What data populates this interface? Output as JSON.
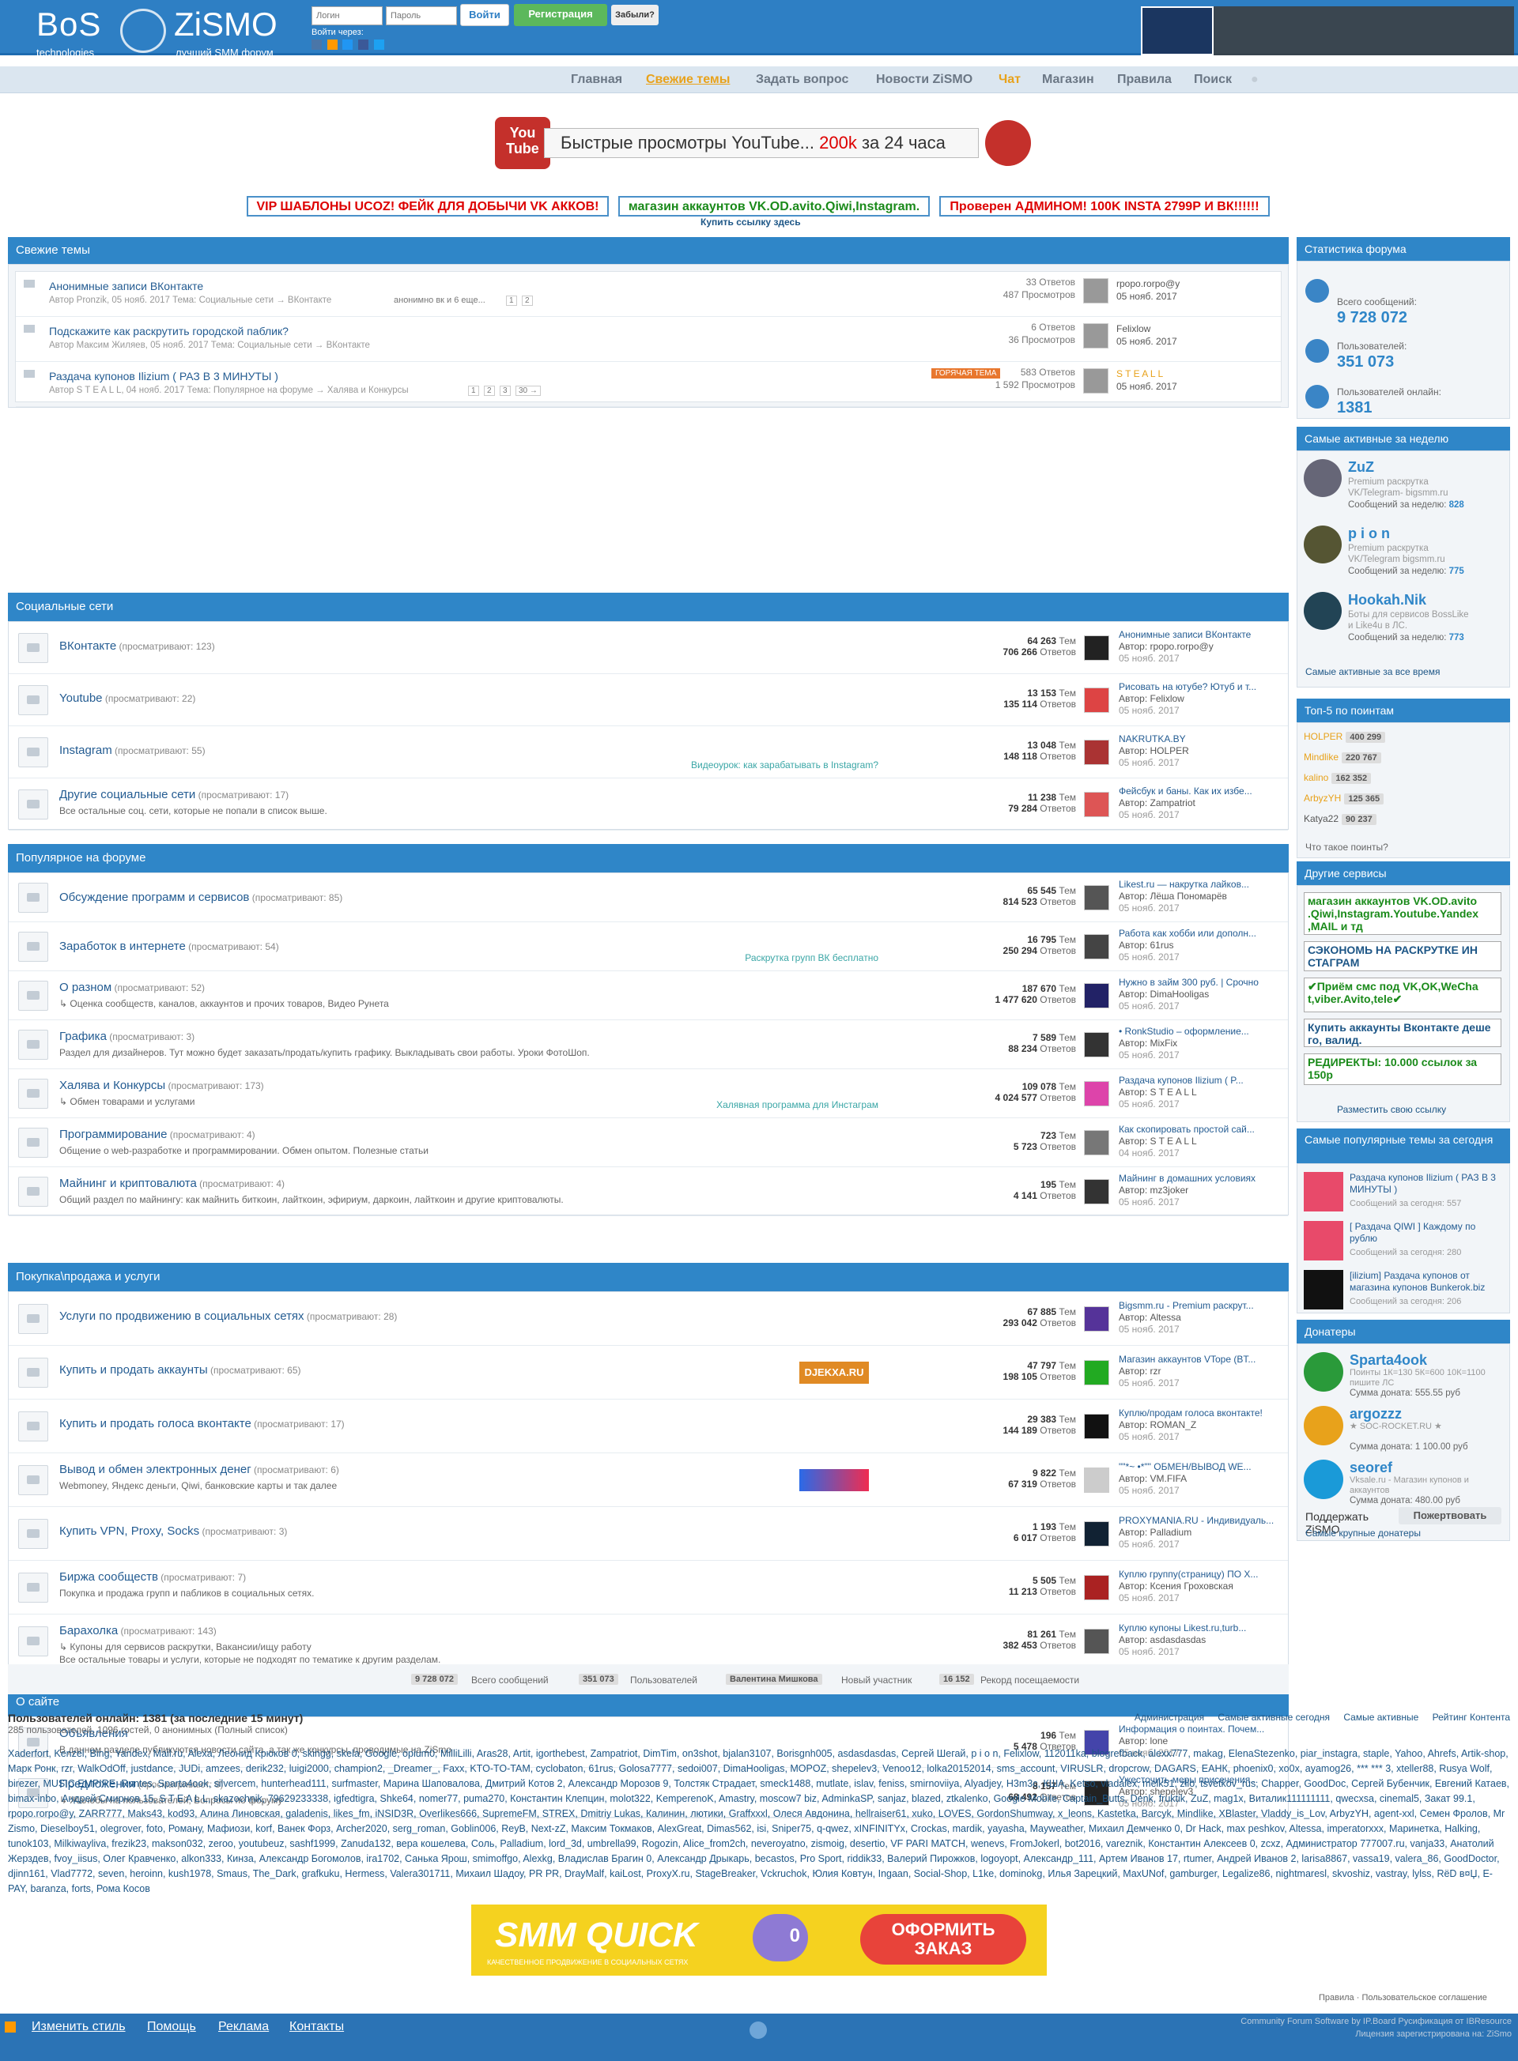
{
  "brand": {
    "left_big": "BoS",
    "left_small": "technologies",
    "right_big": "ZiSMO",
    "right_small": "лучший SMM форум"
  },
  "login": {
    "user_ph": "Логин",
    "pass_ph": "Пароль",
    "login_btn": "Войти",
    "register_btn": "Регистрация",
    "forgot_btn": "Забыли?",
    "via": "Войти через:"
  },
  "nav": {
    "items": [
      "Главная",
      "Свежие темы",
      "Задать вопрос",
      "Новости ZiSMO",
      "Чат",
      "Магазин",
      "Правила",
      "Поиск"
    ],
    "active_color": "#e8a21b"
  },
  "banner": {
    "text_pre": "Быстрые просмотры ",
    "text_yt": "YouTube...",
    "text_red": " 200k",
    "text_post": " за 24 часа",
    "logo_top": "You",
    "logo_bottom": "Tube"
  },
  "ads": {
    "a1": "VIP ШАБЛОНЫ UCOZ! ФЕЙК ДЛЯ ДОБЫЧИ VK АККОВ!",
    "a2": "магазин аккаунтов VK.OD.avito.Qiwi,Instagram.",
    "a3": "Проверен АДМИНОМ! 100K INSTA 2799Р И ВК!!!!!!",
    "buy": "Купить ссылку здесь"
  },
  "fresh": {
    "title": "Свежие темы",
    "topics": [
      {
        "title": "Анонимные записи ВКонтакте",
        "meta": "Автор Pronzik, 05 нояб. 2017 Тема: Социальные сети → ВКонтакте",
        "tag": "анонимно вк и 6 еще...",
        "pages": [
          "1",
          "2"
        ],
        "answers": "33 Ответов",
        "views": "487 Просмотров",
        "user": "rpopo.rorpo@y",
        "date": "05 нояб. 2017"
      },
      {
        "title": "Подскажите как раскрутить городской паблик?",
        "meta": "Автор Максим Жиляев, 05 нояб. 2017 Тема: Социальные сети → ВКонтакте",
        "answers": "6 Ответов",
        "views": "36 Просмотров",
        "user": "Felixlow",
        "date": "05 нояб. 2017"
      },
      {
        "title": "Раздача купонов Ilizium ( РАЗ В 3 МИНУТЫ )",
        "meta": "Автор S T E A L L, 04 нояб. 2017 Тема: Популярное на форуме → Халява и Конкурсы",
        "pages": [
          "1",
          "2",
          "3",
          "30 →"
        ],
        "hot": "ГОРЯЧАЯ ТЕМА",
        "answers": "583 Ответов",
        "views": "1 592 Просмотров",
        "user": "S T E A L L",
        "date": "05 нояб. 2017"
      }
    ]
  },
  "sections": [
    {
      "title": "Социальные сети",
      "forums": [
        {
          "name": "ВКонтакте",
          "view": "(просматривают: 123)",
          "desc": "",
          "mid": "",
          "topics": "64 263",
          "answers": "706 266",
          "last": "Анонимные записи ВКонтакте",
          "author": "Автор: rpopo.rorpo@y",
          "date": "05 нояб. 2017"
        },
        {
          "name": "Youtube",
          "view": "(просматривают: 22)",
          "desc": "",
          "mid": "",
          "topics": "13 153",
          "answers": "135 114",
          "last": "Рисовать на ютубе? Ютуб и т...",
          "author": "Автор: Felixlow",
          "date": "05 нояб. 2017"
        },
        {
          "name": "Instagram",
          "view": "(просматривают: 55)",
          "desc": "",
          "mid": "Видеоурок: как зарабатывать в Instagram?",
          "topics": "13 048",
          "answers": "148 118",
          "last": "NAKRUTKA.BY",
          "author": "Автор: HOLPER",
          "date": "05 нояб. 2017"
        },
        {
          "name": "Другие социальные сети",
          "view": "(просматривают: 17)",
          "desc": "Все остальные соц. сети, которые не попали в список выше.",
          "mid": "",
          "topics": "11 238",
          "answers": "79 284",
          "last": "Фейсбук и баны. Как их избе...",
          "author": "Автор: Zampatriot",
          "date": "05 нояб. 2017"
        }
      ]
    },
    {
      "title": "Популярное на форуме",
      "forums": [
        {
          "name": "Обсуждение программ и сервисов",
          "view": "(просматривают: 85)",
          "desc": "",
          "mid": "",
          "topics": "65 545",
          "answers": "814 523",
          "last": "Likest.ru — накрутка лайков...",
          "author": "Автор: Лёша Пономарёв",
          "date": "05 нояб. 2017"
        },
        {
          "name": "Заработок в интернете",
          "view": "(просматривают: 54)",
          "desc": "",
          "mid": "Раскрутка групп ВК бесплатно",
          "topics": "16 795",
          "answers": "250 294",
          "last": "Работа как хобби или дополн...",
          "author": "Автор: 61rus",
          "date": "05 нояб. 2017"
        },
        {
          "name": "О разном",
          "view": "(просматривают: 52)",
          "desc": "↳ Оценка сообществ, каналов, аккаунтов и прочих товаров,    Видео Рунета",
          "mid": "",
          "topics": "187 670",
          "answers": "1 477 620",
          "last": "Нужно в займ 300 руб. | Срочно",
          "author": "Автор: DimaHooligas",
          "date": "05 нояб. 2017"
        },
        {
          "name": "Графика",
          "view": "(просматривают: 3)",
          "desc": "Раздел для дизайнеров. Тут можно будет заказать/продать/купить графику. Выкладывать свои работы. Уроки ФотоШоп.",
          "mid": "",
          "topics": "7 589",
          "answers": "88 234",
          "last": "• RonkStudio – оформление...",
          "author": "Автор: MixFix",
          "date": "05 нояб. 2017"
        },
        {
          "name": "Халява и Конкурсы",
          "view": "(просматривают: 173)",
          "desc": "↳ Обмен товарами и услугами",
          "mid": "Халявная программа для Инстаграм",
          "topics": "109 078",
          "answers": "4 024 577",
          "last": "Раздача купонов Ilizium ( P...",
          "author": "Автор: S T E A L L",
          "date": "05 нояб. 2017"
        },
        {
          "name": "Программирование",
          "view": "(просматривают: 4)",
          "desc": "Общение о web-разработке и программировании. Обмен опытом. Полезные статьи",
          "mid": "",
          "topics": "723",
          "answers": "5 723",
          "last": "Как скопировать простой сай...",
          "author": "Автор: S T E A L L",
          "date": "04 нояб. 2017"
        },
        {
          "name": "Майнинг и криптовалюта",
          "view": "(просматривают: 4)",
          "desc": "Общий раздел по майнингу: как майнить биткоин, лайткоин, эфириум, даркоин, лайткоин и другие криптовалюты.",
          "mid": "",
          "topics": "195",
          "answers": "4 141",
          "last": "Майнинг в домашних условиях",
          "author": "Автор: mz3joker",
          "date": "05 нояб. 2017"
        }
      ]
    },
    {
      "title": "Покупка\\продажа и услуги",
      "forums": [
        {
          "name": "Услуги по продвижению в социальных сетях",
          "view": "(просматривают: 28)",
          "desc": "",
          "mid": "",
          "topics": "67 885",
          "answers": "293 042",
          "last": "Bigsmm.ru - Premium раскрут...",
          "author": "Автор: Altessa",
          "date": "05 нояб. 2017"
        },
        {
          "name": "Купить и продать аккаунты",
          "view": "(просматривают: 65)",
          "desc": "",
          "mid": "DJEKXA.RU",
          "topics": "47 797",
          "answers": "198 105",
          "last": "Магазин аккаунтов VTope (BT...",
          "author": "Автор: rzr",
          "date": "05 нояб. 2017"
        },
        {
          "name": "Купить и продать голоса вконтакте",
          "view": "(просматривают: 17)",
          "desc": "",
          "mid": "",
          "topics": "29 383",
          "answers": "144 189",
          "last": "Куплю/продам голоса вконтакте!",
          "author": "Автор: ROMAN_Z",
          "date": "05 нояб. 2017"
        },
        {
          "name": "Вывод и обмен электронных денег",
          "view": "(просматривают: 6)",
          "desc": "Webmoney, Яндекс деньги, Qiwi, банковские карты и так далее",
          "mid": "",
          "topics": "9 822",
          "answers": "67 319",
          "last": "\"\"*~ •*\"\" ОБМЕН/ВЫВОД WE...",
          "author": "Автор: VM.FIFA",
          "date": "05 нояб. 2017"
        },
        {
          "name": "Купить VPN, Proxy, Socks",
          "view": "(просматривают: 3)",
          "desc": "",
          "mid": "",
          "topics": "1 193",
          "answers": "6 017",
          "last": "PROXYMANIA.RU - Индивидуаль...",
          "author": "Автор: Palladium",
          "date": "05 нояб. 2017"
        },
        {
          "name": "Биржа сообществ",
          "view": "(просматривают: 7)",
          "desc": "Покупка и продажа групп и пабликов в социальных сетях.",
          "mid": "",
          "topics": "5 505",
          "answers": "11 213",
          "last": "Куплю группу(страницу) ПО Х...",
          "author": "Автор: Ксения Гроховская",
          "date": "05 нояб. 2017"
        },
        {
          "name": "Барахолка",
          "view": "(просматривают: 143)",
          "desc": "↳ Купоны для сервисов раскрутки,    Вакансии/ищу работу",
          "desc2": "Все остальные товары и услуги, которые не подходят по тематике к другим разделам.",
          "mid": "",
          "topics": "81 261",
          "answers": "382 453",
          "last": "Куплю купоны Likest.ru,turb...",
          "author": "Автор: asdasdasdas",
          "date": "05 нояб. 2017"
        }
      ]
    },
    {
      "title": "О сайте",
      "forums": [
        {
          "name": "Объявления",
          "view": "",
          "desc": "В данном разделе публикуются новости сайта, а так же конкурсы, проводимые на ZiSmo",
          "mid": "",
          "topics": "196",
          "answers": "5 478",
          "last": "Информация о поинтах. Почем...",
          "author": "Автор: lone",
          "date": "05 нояб. 2017"
        },
        {
          "name": "Предложения",
          "view": "(просматривают: 8)",
          "desc": "↳ Жалобы на пользователей,    Вопросы по форуму",
          "mid": "",
          "topics": "8 157",
          "answers": "68 492",
          "last": "Ужесточить меры присечения...",
          "author": "Автор: shepelev3",
          "date": "05 нояб. 2017"
        }
      ]
    }
  ],
  "labels": {
    "tem": "Тем",
    "otv": "Ответов"
  },
  "summary": {
    "msgs": "9 728 072",
    "msgs_l": "Всего сообщений",
    "users": "351 073",
    "users_l": "Пользователей",
    "newest": "Валентина Мишкова",
    "newest_l": "Новый участник",
    "record": "16 152",
    "record_l": "Рекорд посещаемости"
  },
  "online": {
    "title": "Пользователей онлайн: 1381 (за последние 15 минут)",
    "sub": "285 пользователей, 1096 гостей, 0 анонимных   (Полный список)",
    "links": [
      "Администрация",
      "Самые активные сегодня",
      "Самые активные",
      "Рейтинг Контента"
    ],
    "text": "Xaderfort, Kenzel, Bing, Yandex, Mail.ru, Alexa, Леонид Крюков 0, skingg, skela, Google, opium0, MilliLilli, Aras28, Artit, igorthebest, Zampatriot, DimTim, on3shot, bjalan3107, Borisgnh005, asdasdasdas, Сергей Шегай, p i o n, Felixlow, 112011ka, blogrefback, alexx777, makag, ElenaStezenko, piar_instagra, staple, Yahoo, Ahrefs, Artik-shop, Марк Ронк, rzr, WalkOdOff, justdance, JUDi, amzees, derik232, luigi2000, champion2, _Dreamer_, Faxx, KTO-TO-TAM, cyclobaton, 61rus, Golosa7777, sedoi007, DimaHooligas, MOPOZ, shepelev3, Venoo12, lolka20152014, sms_account, VIRUSLR, dropcrow, DAGARS, ЕАНК, phoenix0, xo0x, ayamog26, *** *** 3, xteller88, Rusya Wolf, birezer, MUSIC EMPIRE, Runtes, Sparta4ook, silvercem, hunterhead111, surfmaster, Марина Шаповалова, Дмитрий Котов 2, Александр Морозов 9, Толстяк Страдает, smeck1488, mutlate, islav, feniss, smirnoviiya, Alyadjey, H3m3c, КША, Ketso, vladalex, melk51, zllo, tsvetkov_rus, Chapper, GoodDoc, Сергей Бубенчик, Евгений Катаев, bimax-inbo, Андрей Смирнов 15, S T E A L L, skazochnik, 79629233338, igfedtigra, Shke64, nomer77, puma270, Константин Клепцин, molot322, KemperenoK, Amastry, moscow7 biz, AdminkaSP, sanjaz, blazed, ztkalenko, Google Mobile, Captain_Butts, Denk, fruktik, ZuZ, mag1x, Виталик111111111, qwecxsa, cinemal5, Закат 99.1, rpopo.rorpo@y, ZARR777, Maks43, kod93, Алина Линовская, galadenis, likes_fm, iNSID3R, Overlikes666, SupremeFM, STREX, Dmitriy Lukas, Калинин, лютики, Graffxxxl, Олеся Авдонина, hellraiser61, xuko, LOVES, GordonShumway, x_leons, Kastetka, Barcyk, Mindlike, XBlaster, Vladdy_is_Lov, ArbyzYH, agent-xxl, Семен Фролов, Mr Zismo, Dieselboy51, olegrover, foto, Роману, Мафиози, korf, Ванек Форз, Archer2020, serg_roman, Goblin006, ReyB, Next-zZ, Максим Токмаков, AlexGreat, Dimas562, isi, Sniper75, q-qwez, xINFINITYx, Crockas, mardik, yayasha, Mayweather, Михаил Демченко 0, Dr Hack, max peshkov, Altessa, imperatorxxx, Маринетка, Halking, tunok103, Milkiwayliva, frezik23, makson032, zeroo, youtubeuz, sashf1999, Zanuda132, вера кошелева, Соль, Palladium, lord_3d, umbrella99, Rogozin, Alice_from2ch, neveroyatno, zismoig, desertio, VF PARI MATCH, wenevs, FromJokerl, bot2016, vareznik, Константин Алексеев 0, zcxz, Администратор 777007.ru, vanja33, Анатолий Жерздев, fvoy_iisus, Олег Кравченко, alkon333, Кинза, Александр Богомолов, ira1702, Санька Ярош, smimoffgo, Alexkg, Владислав Брагин 0, Александр Дрыкарь, becastos, Pro Sport, riddik33, Валерий Пирожков, logoyopt, Александр_111, Артем Иванов 17, rtumer, Андрей Иванов 2, larisa8867, vassa19, valera_86, GoodDoctor, djinn161, Vlad7772, seven, heroinn, kush1978, Smaus, The_Dark, grafkuku, Hermess, Valera301711, Михаил Шадоу, PR PR, DrayMalf, kaiLost, ProxyX.ru, StageBreaker, Vckruchok, Юлия Ковтун, Ingaan, Social-Shop, L1ke, dominokg, Илья Зарецкий, MaxUNof, gamburger, Legalize86, nightmaresl, skvoshiz, vastray, lylss, RёD в¤Џ, E-PAY, baranza, forts, Рома Косов"
  },
  "side": {
    "stats_title": "Статистика форума",
    "s1_l": "Всего сообщений:",
    "s1": "9 728 072",
    "s2_l": "Пользователей:",
    "s2": "351 073",
    "s3_l": "Пользователей онлайн:",
    "s3": "1381",
    "week_title": "Самые активные за неделю",
    "week": [
      {
        "name": "ZuZ",
        "desc": "Premium раскрутка VK/Telegram- bigsmm.ru",
        "msgs_l": "Сообщений за неделю:",
        "msgs": "828"
      },
      {
        "name": "p i o n",
        "desc": "Premium раскрутка VK/Telegram bigsmm.ru",
        "msgs_l": "Сообщений за неделю:",
        "msgs": "775"
      },
      {
        "name": "Hookah.Nik",
        "desc": "Боты для сервисов BossLike и Like4u в ЛС.",
        "msgs_l": "Сообщений за неделю:",
        "msgs": "773"
      }
    ],
    "alltime": "Самые активные за все время",
    "top5_title": "Топ-5 по поинтам",
    "top5": [
      {
        "n": "HOLPER",
        "p": "400 299"
      },
      {
        "n": "Mindlike",
        "p": "220 767"
      },
      {
        "n": "kalino",
        "p": "162 352"
      },
      {
        "n": "ArbyzYH",
        "p": "125 365"
      },
      {
        "n": "Katya22",
        "p": "90 237"
      }
    ],
    "points_q": "Что такое поинты?",
    "services_title": "Другие сервисы",
    "services": [
      "магазин аккаунтов VK.OD.avito .Qiwi,Instagram.Youtube.Yandex ,MAIL и тд",
      "СЭКОНОМЬ НА РАСКРУТКЕ ИН СТАГРАМ",
      "✔Приём смс под VK,OK,WeCha t,viber.Avito,tele✔",
      "Купить аккаунты Вконтакте деше го, валид.",
      "РЕДИРЕКТЫ: 10.000 ссылок за 150р"
    ],
    "place_link": "Разместить свою ссылку",
    "pop_title": "Самые популярные темы за сегодня",
    "pop": [
      {
        "t": "Раздача купонов Ilizium ( РАЗ В 3 МИНУТЫ )",
        "m": "Сообщений за сегодня: 557"
      },
      {
        "t": "[ Раздача QIWI ] Каждому по рублю",
        "m": "Сообщений за сегодня: 280"
      },
      {
        "t": "[ilizium] Раздача купонов от магазина купонов Bunkerok.biz",
        "m": "Сообщений за сегодня: 206"
      }
    ],
    "don_title": "Донатеры",
    "donors": [
      {
        "n": "Sparta4ook",
        "d": "Поинты 1К=130 5К=600 10К=1100 пишите ЛС",
        "s": "Сумма доната:",
        "v": "555.55 руб"
      },
      {
        "n": "argozzz",
        "d": "★ SOC-ROCKET.RU ★",
        "s": "Сумма доната:",
        "v": "1 100.00 руб"
      },
      {
        "n": "seoref",
        "d": "Vksale.ru - Магазин купонов и аккаунтов",
        "s": "Сумма доната:",
        "v": "480.00 руб"
      }
    ],
    "support": "Поддержать ZiSMO",
    "donate_btn": "Пожертвовать",
    "big_donors": "Самые крупные донатеры"
  },
  "smmquick": {
    "big": "SMM QUICK",
    "small": "КАЧЕСТВЕННОЕ ПРОДВИЖЕНИЕ В СОЦИАЛЬНЫХ СЕТЯХ",
    "badge": "0",
    "btn1": "ОФОРМИТЬ",
    "btn2": "ЗАКАЗ"
  },
  "bottom": {
    "rules": "Правила · Пользовательское соглашение",
    "links": [
      "Изменить стиль",
      "Помощь",
      "Реклама",
      "Контакты"
    ],
    "copy1": "Community Forum Software by IP.Board Русификация от IBResource",
    "copy2": "Лицензия зарегистрирована на: ZiSmo"
  }
}
